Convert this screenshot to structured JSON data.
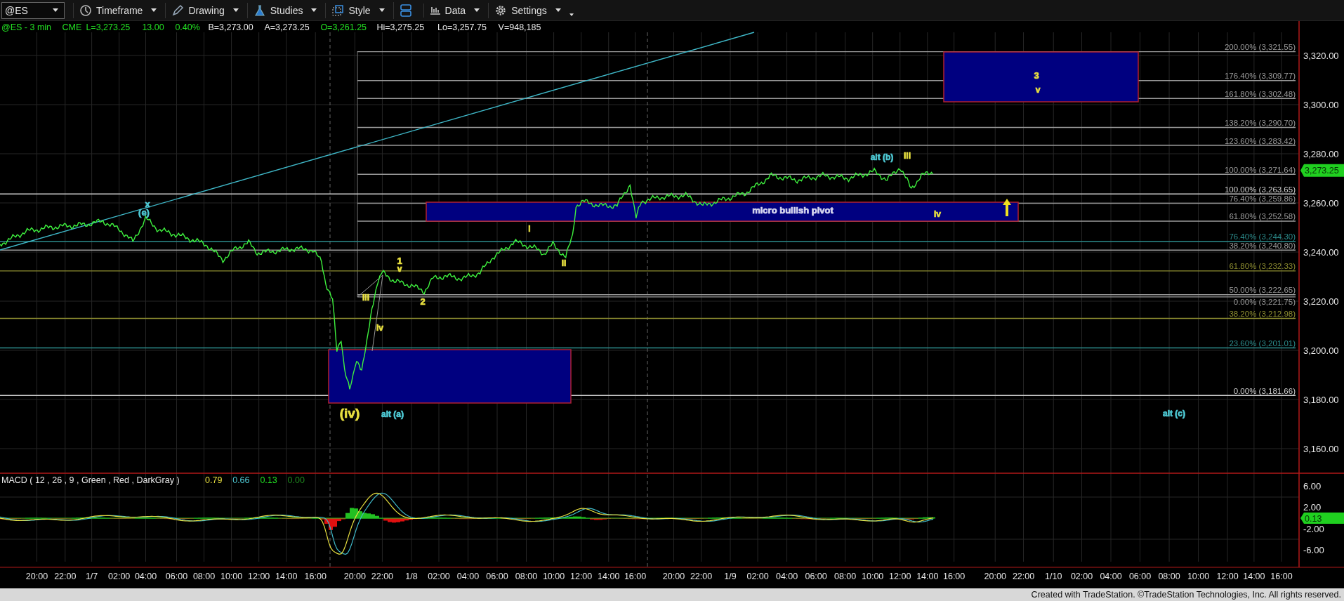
{
  "toolbar": {
    "symbol": "@ES",
    "menus": [
      {
        "kind": "timeframe",
        "label": "Timeframe"
      },
      {
        "kind": "drawing",
        "label": "Drawing"
      },
      {
        "kind": "studies",
        "label": "Studies"
      },
      {
        "kind": "style",
        "label": "Style"
      },
      {
        "kind": "layout"
      },
      {
        "kind": "data",
        "label": "Data"
      },
      {
        "kind": "settings",
        "label": "Settings"
      }
    ]
  },
  "quote": [
    {
      "text": "@ES - 3 min",
      "color": "#22e022"
    },
    {
      "text": "CME",
      "color": "#22e022"
    },
    {
      "text": "L=3,273.25",
      "color": "#22e022"
    },
    {
      "text": "13.00",
      "color": "#22e022"
    },
    {
      "text": "0.40%",
      "color": "#22e022"
    },
    {
      "text": "B=3,273.00",
      "color": "#e8e8e8"
    },
    {
      "text": "A=3,273.25",
      "color": "#e8e8e8"
    },
    {
      "text": "O=3,261.25",
      "color": "#22e022"
    },
    {
      "text": "Hi=3,275.25",
      "color": "#e8e8e8"
    },
    {
      "text": "Lo=3,257.75",
      "color": "#e8e8e8"
    },
    {
      "text": "V=948,185",
      "color": "#e8e8e8"
    }
  ],
  "price_axis": {
    "ticks": [
      "3,320.00",
      "3,300.00",
      "3,280.00",
      "3,260.00",
      "3,240.00",
      "3,220.00",
      "3,200.00",
      "3,180.00",
      "3,160.00"
    ],
    "last_price": "3,273.25"
  },
  "fib_levels": [
    {
      "label": "200.00% (3,321.55)",
      "color": "#9a9a9a"
    },
    {
      "label": "176.40% (3,309.77)",
      "color": "#9a9a9a"
    },
    {
      "label": "161.80% (3,302.48)",
      "color": "#9a9a9a"
    },
    {
      "label": "138.20% (3,290.70)",
      "color": "#9a9a9a"
    },
    {
      "label": "123.60% (3,283.42)",
      "color": "#9a9a9a"
    },
    {
      "label": "100.00% (3,271.64)",
      "color": "#9a9a9a"
    },
    {
      "label": "100.00% (3,263.65)",
      "color": "#d0d0d0"
    },
    {
      "label": "76.40% (3,259.86)",
      "color": "#9a9a9a"
    },
    {
      "label": "61.80% (3,252.58)",
      "color": "#9a9a9a"
    },
    {
      "label": "76.40% (3,244.30)",
      "color": "#2c8c8c"
    },
    {
      "label": "38.20% (3,240.80)",
      "color": "#9a9a9a"
    },
    {
      "label": "61.80% (3,232.33)",
      "color": "#8c8c30"
    },
    {
      "label": "50.00% (3,222.65)",
      "color": "#9a9a9a"
    },
    {
      "label": "0.00% (3,221.75)",
      "color": "#9a9a9a"
    },
    {
      "label": "38.20% (3,212.98)",
      "color": "#8c8c30"
    },
    {
      "label": "23.60% (3,201.01)",
      "color": "#2c8c8c"
    },
    {
      "label": "0.00% (3,181.66)",
      "color": "#d0d0d0"
    }
  ],
  "annotations": [
    {
      "text": "x",
      "color": "#4ec9d4"
    },
    {
      "text": "(e)",
      "color": "#4ec9d4"
    },
    {
      "text": "1",
      "color": "#e8e040"
    },
    {
      "text": "v",
      "color": "#e8e040"
    },
    {
      "text": "iii",
      "color": "#e8e040"
    },
    {
      "text": "iv",
      "color": "#e8e040"
    },
    {
      "text": "2",
      "color": "#e8e040"
    },
    {
      "text": "i",
      "color": "#e8e040"
    },
    {
      "text": "ii",
      "color": "#e8e040"
    },
    {
      "text": "(iv)",
      "color": "#e8e040"
    },
    {
      "text": "alt (a)",
      "color": "#4ec9d4"
    },
    {
      "text": "micro bullish pivot",
      "color": "#d8d8f0"
    },
    {
      "text": "alt (b)",
      "color": "#4ec9d4"
    },
    {
      "text": "iii",
      "color": "#e8e040"
    },
    {
      "text": "iv",
      "color": "#e8e040"
    },
    {
      "text": "3",
      "color": "#e8e040"
    },
    {
      "text": "v",
      "color": "#e8e040"
    },
    {
      "text": "alt (c)",
      "color": "#4ec9d4"
    }
  ],
  "macd": {
    "title": "MACD ( 12 , 26 , 9 , Green , Red , DarkGray )",
    "values": [
      {
        "text": "0.79",
        "color": "#e8e040"
      },
      {
        "text": "0.66",
        "color": "#4ec9d4"
      },
      {
        "text": "0.13",
        "color": "#22e022"
      },
      {
        "text": "0.00",
        "color": "#1f8a1f"
      }
    ],
    "ticks": [
      "6.00",
      "2.00",
      "-2.00",
      "-6.00"
    ],
    "last_value": "0.13"
  },
  "time_axis": [
    "20:00",
    "22:00",
    "1/7",
    "02:00",
    "04:00",
    "06:00",
    "08:00",
    "10:00",
    "12:00",
    "14:00",
    "16:00",
    "20:00",
    "22:00",
    "1/8",
    "02:00",
    "04:00",
    "06:00",
    "08:00",
    "10:00",
    "12:00",
    "14:00",
    "16:00",
    "20:00",
    "22:00",
    "1/9",
    "02:00",
    "04:00",
    "06:00",
    "08:00",
    "10:00",
    "12:00",
    "14:00",
    "16:00",
    "20:00",
    "22:00",
    "1/10",
    "02:00",
    "04:00",
    "06:00",
    "08:00",
    "10:00",
    "12:00",
    "14:00",
    "16:00"
  ],
  "footer": "Created with TradeStation. ©TradeStation Technologies, Inc. All rights reserved."
}
